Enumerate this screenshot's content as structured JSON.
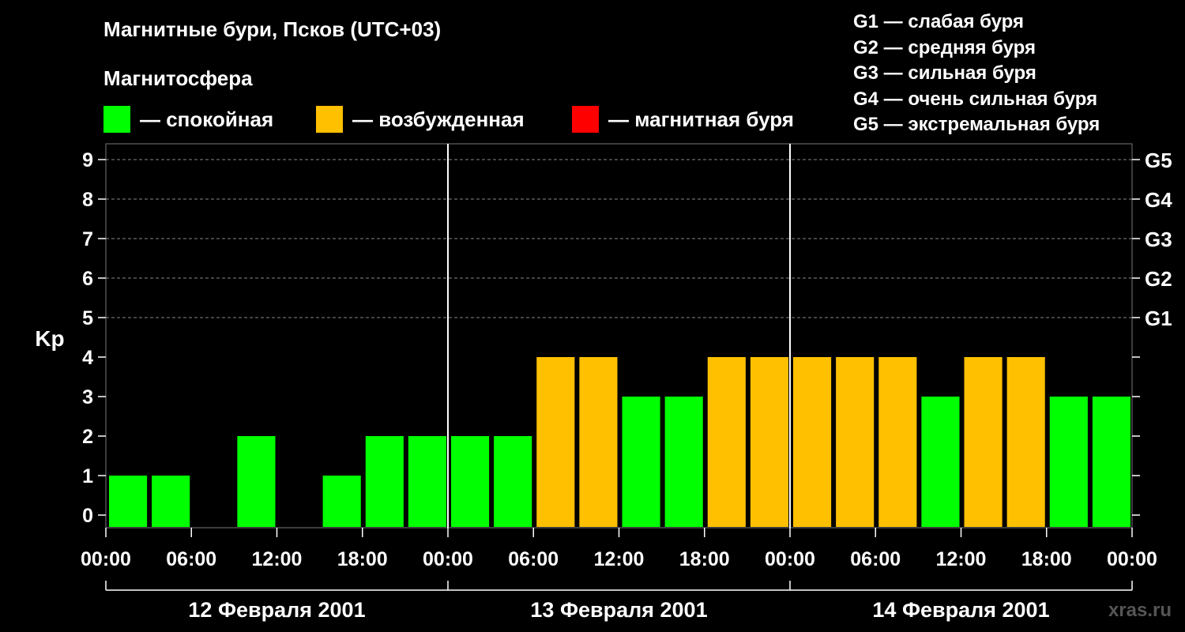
{
  "title": "Магнитные бури, Псков (UTC+03)",
  "subtitle": "Магнитосфера",
  "legend": [
    {
      "label": "— спокойная",
      "color": "#00ff00"
    },
    {
      "label": "— возбужденная",
      "color": "#ffc000"
    },
    {
      "label": "— магнитная буря",
      "color": "#ff0000"
    }
  ],
  "storm_levels": [
    "G1 — слабая буря",
    "G2 — средняя буря",
    "G3 — сильная буря",
    "G4 — очень сильная буря",
    "G5 — экстремальная буря"
  ],
  "watermark": "xras.ru",
  "chart_data": {
    "type": "bar",
    "ylabel": "Kp",
    "ylim": [
      0,
      9
    ],
    "yticks": [
      "0",
      "1",
      "2",
      "3",
      "4",
      "5",
      "6",
      "7",
      "8",
      "9"
    ],
    "right_ticks": [
      {
        "value": 5,
        "label": "G1"
      },
      {
        "value": 6,
        "label": "G2"
      },
      {
        "value": 7,
        "label": "G3"
      },
      {
        "value": 8,
        "label": "G4"
      },
      {
        "value": 9,
        "label": "G5"
      }
    ],
    "xtick_labels": [
      "00:00",
      "06:00",
      "12:00",
      "18:00",
      "00:00",
      "06:00",
      "12:00",
      "18:00",
      "00:00",
      "06:00",
      "12:00",
      "18:00",
      "00:00"
    ],
    "days": [
      "12 Февраля 2001",
      "13 Февраля 2001",
      "14 Февраля 2001"
    ],
    "values": [
      1,
      1,
      0,
      2,
      0,
      1,
      2,
      2,
      2,
      2,
      4,
      4,
      3,
      3,
      4,
      4,
      4,
      4,
      4,
      3,
      4,
      4,
      3,
      3
    ],
    "colors": [
      "#00ff00",
      "#00ff00",
      "#00ff00",
      "#00ff00",
      "#00ff00",
      "#00ff00",
      "#00ff00",
      "#00ff00",
      "#00ff00",
      "#00ff00",
      "#ffc000",
      "#ffc000",
      "#00ff00",
      "#00ff00",
      "#ffc000",
      "#ffc000",
      "#ffc000",
      "#ffc000",
      "#ffc000",
      "#00ff00",
      "#ffc000",
      "#ffc000",
      "#00ff00",
      "#00ff00"
    ],
    "grid": true
  }
}
